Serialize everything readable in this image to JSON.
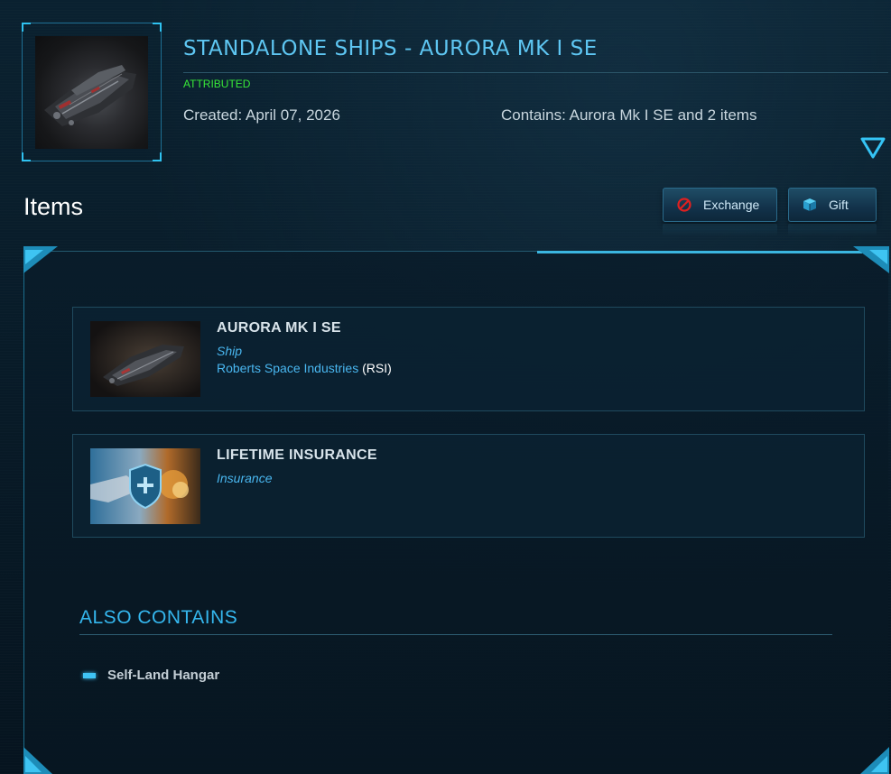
{
  "header": {
    "title": "STANDALONE SHIPS - AURORA MK I SE",
    "status": "ATTRIBUTED",
    "created": "Created: April 07, 2026",
    "contains": "Contains: Aurora Mk I SE and 2 items",
    "thumbnail_icon": "ship-thumbnail-icon",
    "toggle_icon": "chevron-down-icon"
  },
  "toolbar": {
    "heading": "Items",
    "exchange_label": "Exchange",
    "exchange_icon": "no-entry-icon",
    "gift_label": "Gift",
    "gift_icon": "gift-box-icon"
  },
  "items": [
    {
      "name": "AURORA MK I SE",
      "type": "Ship",
      "manufacturer": "Roberts Space Industries",
      "manufacturer_abbr": "(RSI)",
      "thumbnail_icon": "ship-thumbnail-icon"
    },
    {
      "name": "LIFETIME INSURANCE",
      "type": "Insurance",
      "thumbnail_icon": "insurance-shield-icon"
    }
  ],
  "also_contains": {
    "heading": "ALSO CONTAINS",
    "items": [
      "Self-Land Hangar"
    ]
  },
  "colors": {
    "accent": "#35b7ee",
    "status_green": "#38e838",
    "background": "#071a26",
    "link_blue": "#49b6ef"
  }
}
